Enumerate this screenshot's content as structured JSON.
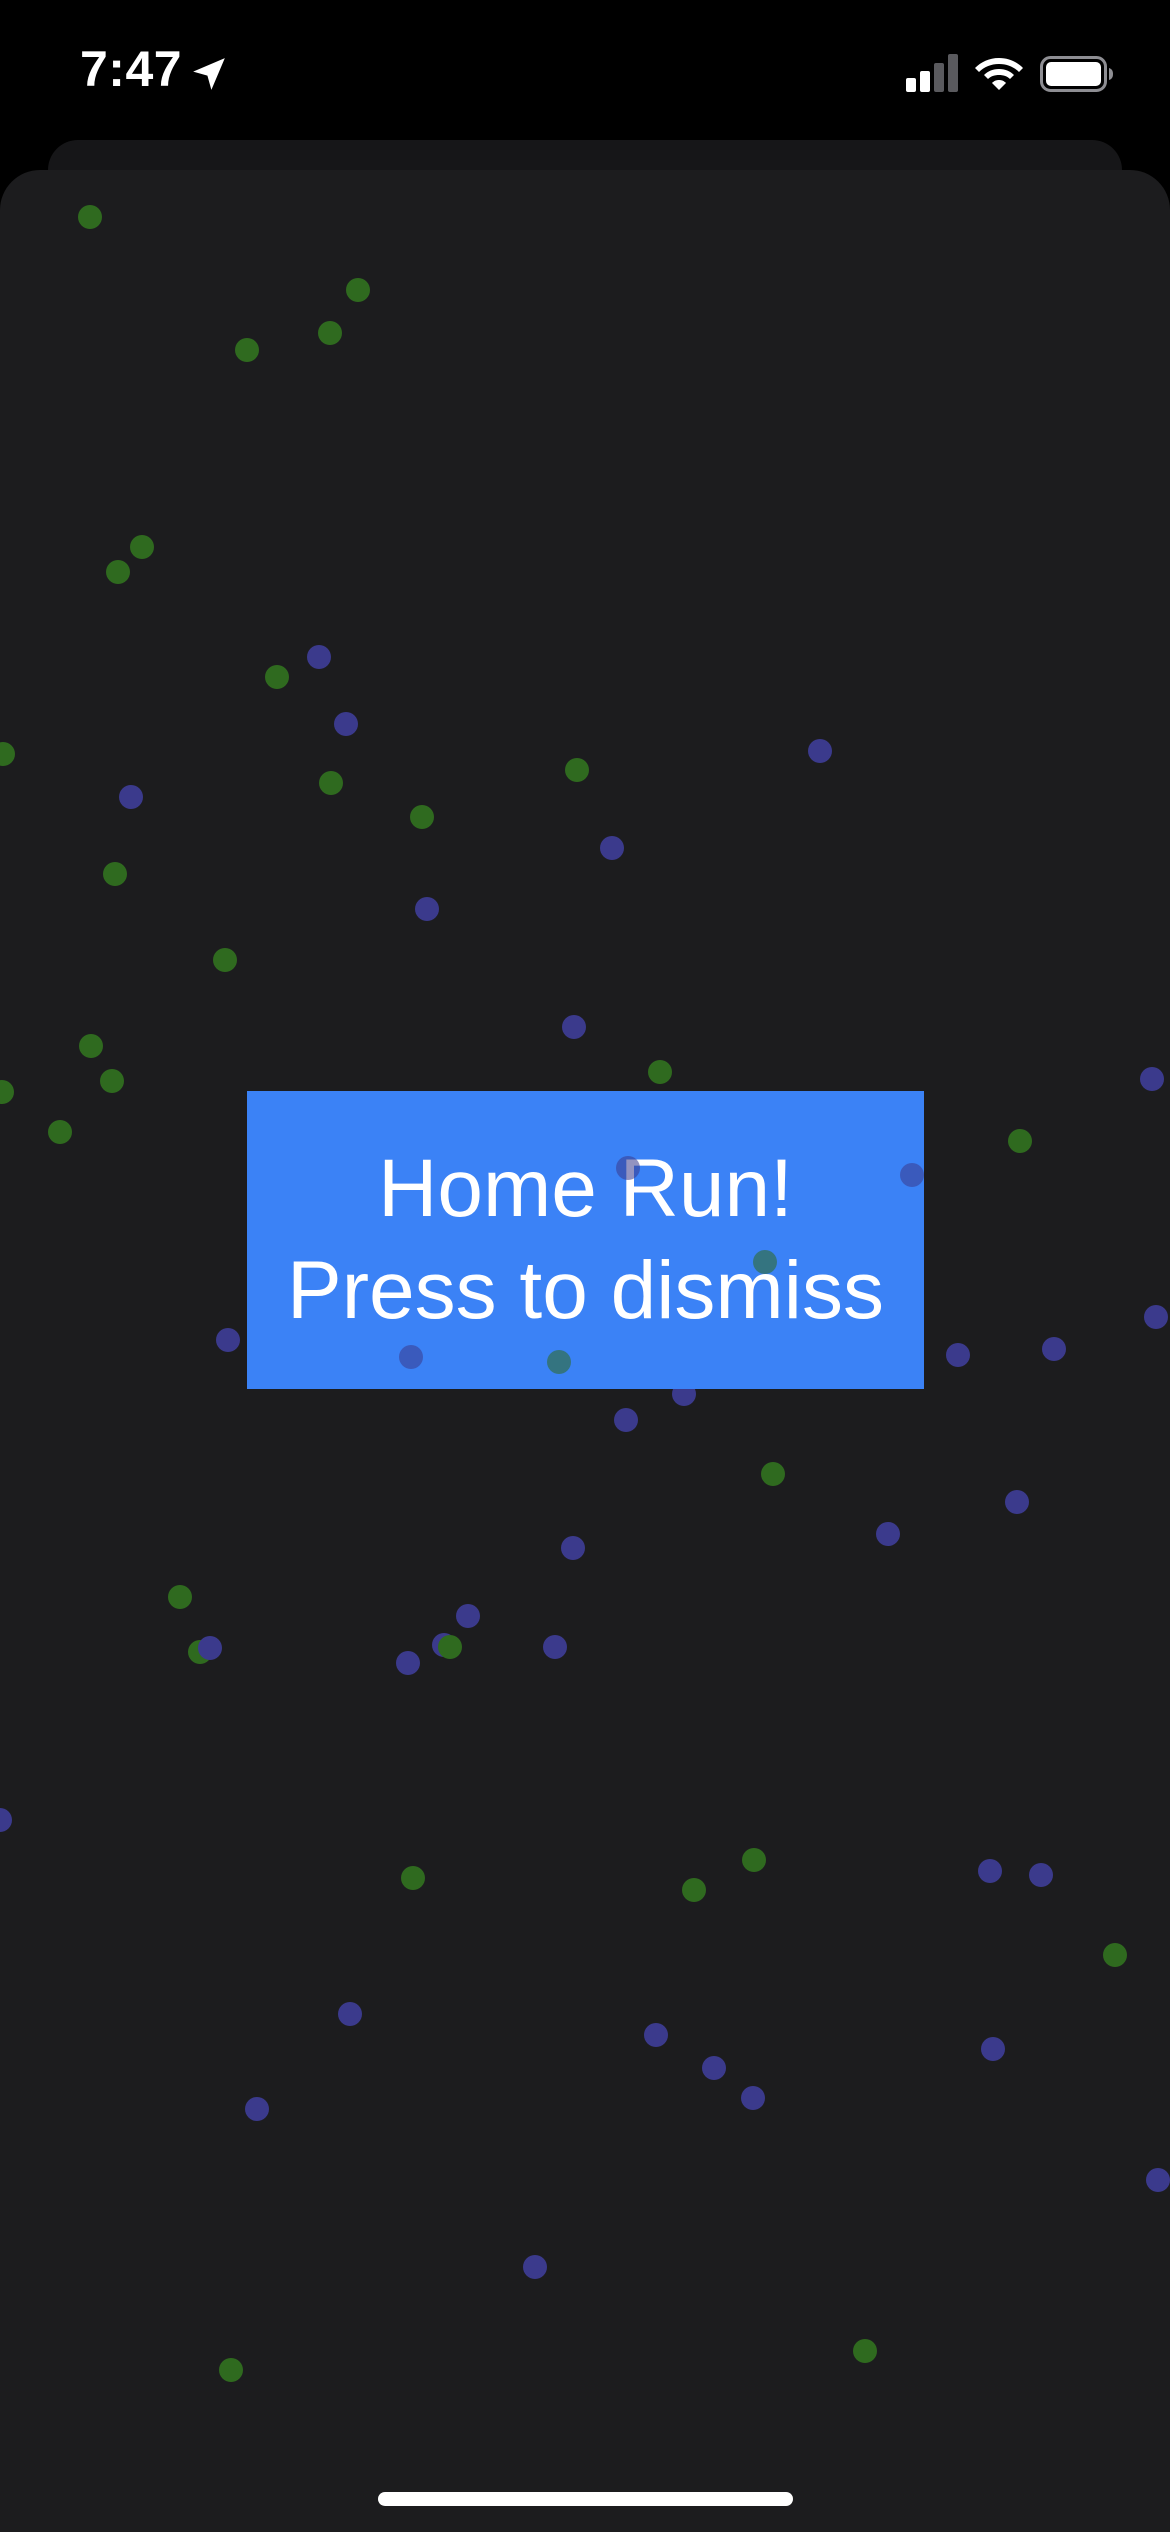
{
  "status_bar": {
    "time": "7:47",
    "location_icon": "location-arrow-icon",
    "signal_icon": "cellular-signal-icon",
    "wifi_icon": "wifi-icon",
    "battery_icon": "battery-icon",
    "signal_bars_active": 2,
    "signal_bars_total": 4,
    "battery_level": 1.0
  },
  "banner": {
    "line1": "Home Run!",
    "line2": "Press to dismiss",
    "color": "#3b82f6",
    "text_color": "#ffffff"
  },
  "colors": {
    "background": "#000000",
    "sheet": "#1c1c1e",
    "particle_green": "#2f6a1f",
    "particle_blue": "#3b3a8c"
  }
}
